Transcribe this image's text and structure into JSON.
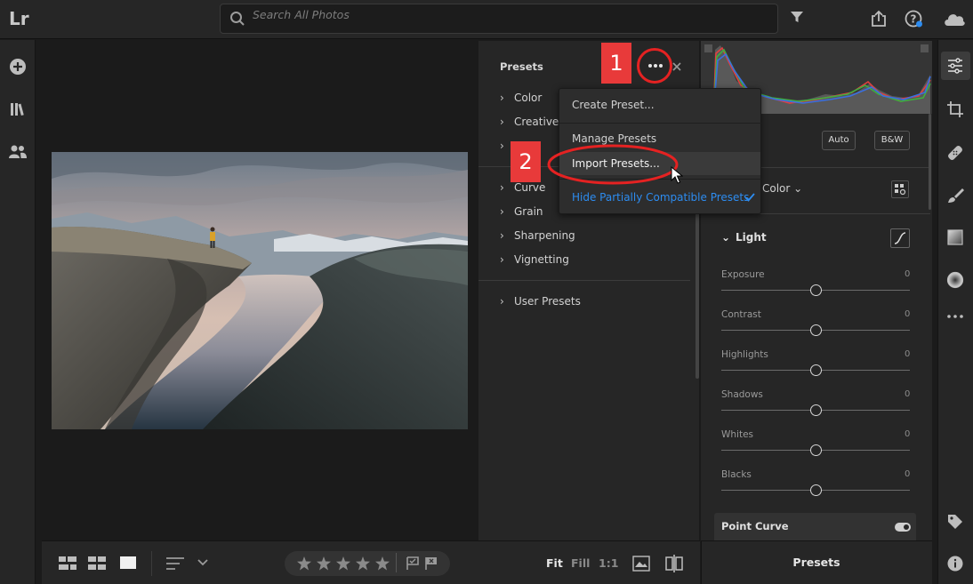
{
  "app": {
    "logo": "Lr"
  },
  "search": {
    "placeholder": "Search All Photos"
  },
  "presets_panel": {
    "title": "Presets",
    "groups": [
      "Color",
      "Creative",
      "",
      "Curve",
      "Grain",
      "Sharpening",
      "Vignetting"
    ],
    "user_presets": "User Presets"
  },
  "menu": {
    "create": "Create Preset...",
    "manage": "Manage Presets",
    "import": "Import Presets...",
    "hide": "Hide Partially Compatible Presets"
  },
  "annotations": {
    "step1": "1",
    "step2": "2"
  },
  "edit_panel": {
    "auto_label": "Auto",
    "bw_label": "B&W",
    "profile_label": "Color",
    "light_title": "Light",
    "sliders": [
      {
        "name": "Exposure",
        "value": "0"
      },
      {
        "name": "Contrast",
        "value": "0"
      },
      {
        "name": "Highlights",
        "value": "0"
      },
      {
        "name": "Shadows",
        "value": "0"
      },
      {
        "name": "Whites",
        "value": "0"
      },
      {
        "name": "Blacks",
        "value": "0"
      }
    ],
    "point_curve": "Point Curve"
  },
  "bottom_bar": {
    "fit": "Fit",
    "fill": "Fill",
    "one_to_one": "1:1",
    "presets_tab": "Presets"
  },
  "colors": {
    "accent_blue": "#2d8cf0",
    "annotation_red": "#e83a3a"
  }
}
